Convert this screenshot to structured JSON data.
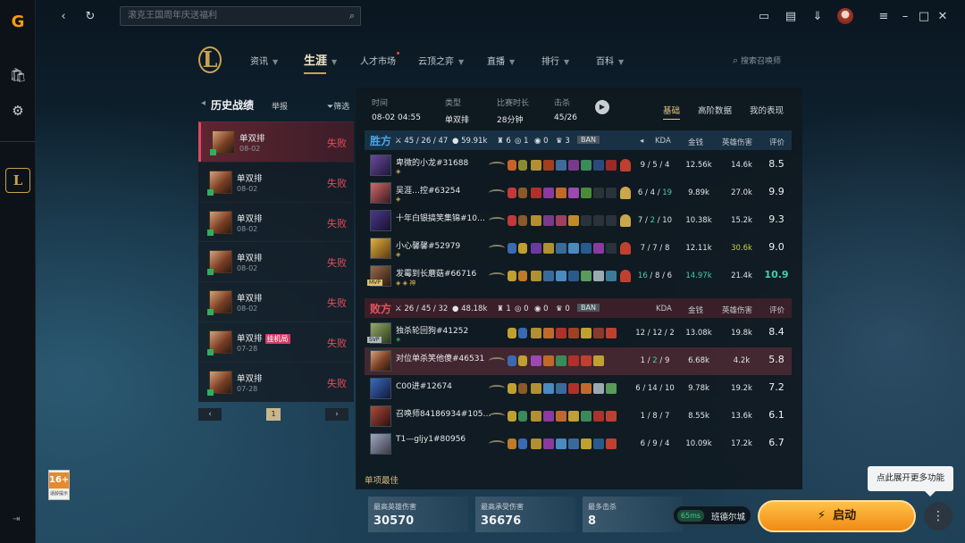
{
  "topbar": {
    "search_placeholder": "滚克王国周年庆送福利"
  },
  "nav": {
    "items": [
      {
        "label": "资讯"
      },
      {
        "label": "生涯"
      },
      {
        "label": "人才市场"
      },
      {
        "label": "云顶之弈"
      },
      {
        "label": "直播"
      },
      {
        "label": "排行"
      },
      {
        "label": "百科"
      }
    ],
    "search_label": "搜索召唤师"
  },
  "history": {
    "title": "历史战绩",
    "report": "举报",
    "filter": "筛选",
    "rows": [
      {
        "mode": "单双排",
        "date": "08-02",
        "result": "失败",
        "tag": ""
      },
      {
        "mode": "单双排",
        "date": "08-02",
        "result": "失败",
        "tag": ""
      },
      {
        "mode": "单双排",
        "date": "08-02",
        "result": "失败",
        "tag": ""
      },
      {
        "mode": "单双排",
        "date": "08-02",
        "result": "失败",
        "tag": ""
      },
      {
        "mode": "单双排",
        "date": "08-02",
        "result": "失败",
        "tag": ""
      },
      {
        "mode": "单双排",
        "date": "07-28",
        "result": "失败",
        "tag": "挂机局"
      },
      {
        "mode": "单双排",
        "date": "07-28",
        "result": "失败",
        "tag": ""
      }
    ],
    "page": "1"
  },
  "detail": {
    "time_label": "时间",
    "time": "08-02 04:55",
    "type_label": "类型",
    "type": "单双排",
    "duration_label": "比赛时长",
    "duration": "28分钟",
    "kills_label": "击杀",
    "kills": "45/26",
    "tabs": [
      "基础",
      "高阶数据",
      "我的表现"
    ],
    "col_kda": "KDA",
    "col_gold": "金钱",
    "col_dmg": "英雄伤害",
    "col_score": "评价",
    "ban_label": "BAN",
    "win": {
      "name": "胜方",
      "kda": "45 / 26 / 47",
      "gold": "59.91k",
      "towers": "6",
      "dragons": "1",
      "barons": "0",
      "heralds": "3",
      "players": [
        {
          "name": "卑微的小龙#31688",
          "kda": "9 / 5 / 4",
          "gold": "12.56k",
          "dmg": "14.6k",
          "score": "8.5"
        },
        {
          "name": "吴涯…控#63254",
          "kda": "6 / 4 / 19",
          "gold": "9.89k",
          "dmg": "27.0k",
          "score": "9.9"
        },
        {
          "name": "十年白银搞笑集锦#10…",
          "kda": "7 / 2 / 10",
          "gold": "10.38k",
          "dmg": "15.2k",
          "score": "9.3"
        },
        {
          "name": "小心馨馨#52979",
          "kda": "7 / 7 / 8",
          "gold": "12.11k",
          "dmg": "30.6k",
          "score": "9.0"
        },
        {
          "name": "发霉到长蘑菇#66716",
          "kda": "16 / 8 / 6",
          "gold": "14.97k",
          "dmg": "21.4k",
          "score": "10.9",
          "badge": "MVP"
        }
      ]
    },
    "lose": {
      "name": "败方",
      "kda": "26 / 45 / 32",
      "gold": "48.18k",
      "towers": "1",
      "dragons": "0",
      "barons": "0",
      "heralds": "0",
      "players": [
        {
          "name": "独杀轮回狗#41252",
          "kda": "12 / 12 / 2",
          "gold": "13.08k",
          "dmg": "19.8k",
          "score": "8.4",
          "badge": "SVP"
        },
        {
          "name": "对位单杀笑他傻#46531",
          "kda": "1 / 2 / 9",
          "gold": "6.68k",
          "dmg": "4.2k",
          "score": "5.8"
        },
        {
          "name": "C00进#12674",
          "kda": "6 / 14 / 10",
          "gold": "9.78k",
          "dmg": "19.2k",
          "score": "7.2"
        },
        {
          "name": "召唤师84186934#105…",
          "kda": "1 / 8 / 7",
          "gold": "8.55k",
          "dmg": "13.6k",
          "score": "6.1"
        },
        {
          "name": "T1—gljy1#80956",
          "kda": "6 / 9 / 4",
          "gold": "10.09k",
          "dmg": "17.2k",
          "score": "6.7"
        }
      ]
    },
    "best_title": "单项最佳",
    "best": [
      {
        "label": "最高英雄伤害",
        "value": "30570"
      },
      {
        "label": "最高承受伤害",
        "value": "36676"
      },
      {
        "label": "最多击杀",
        "value": "8"
      }
    ]
  },
  "age": {
    "rating": "16+",
    "label": "适龄提示"
  },
  "region": {
    "ping": "65ms",
    "name": "班德尔城"
  },
  "launch_label": "启动",
  "tooltip": "点此展开更多功能"
}
